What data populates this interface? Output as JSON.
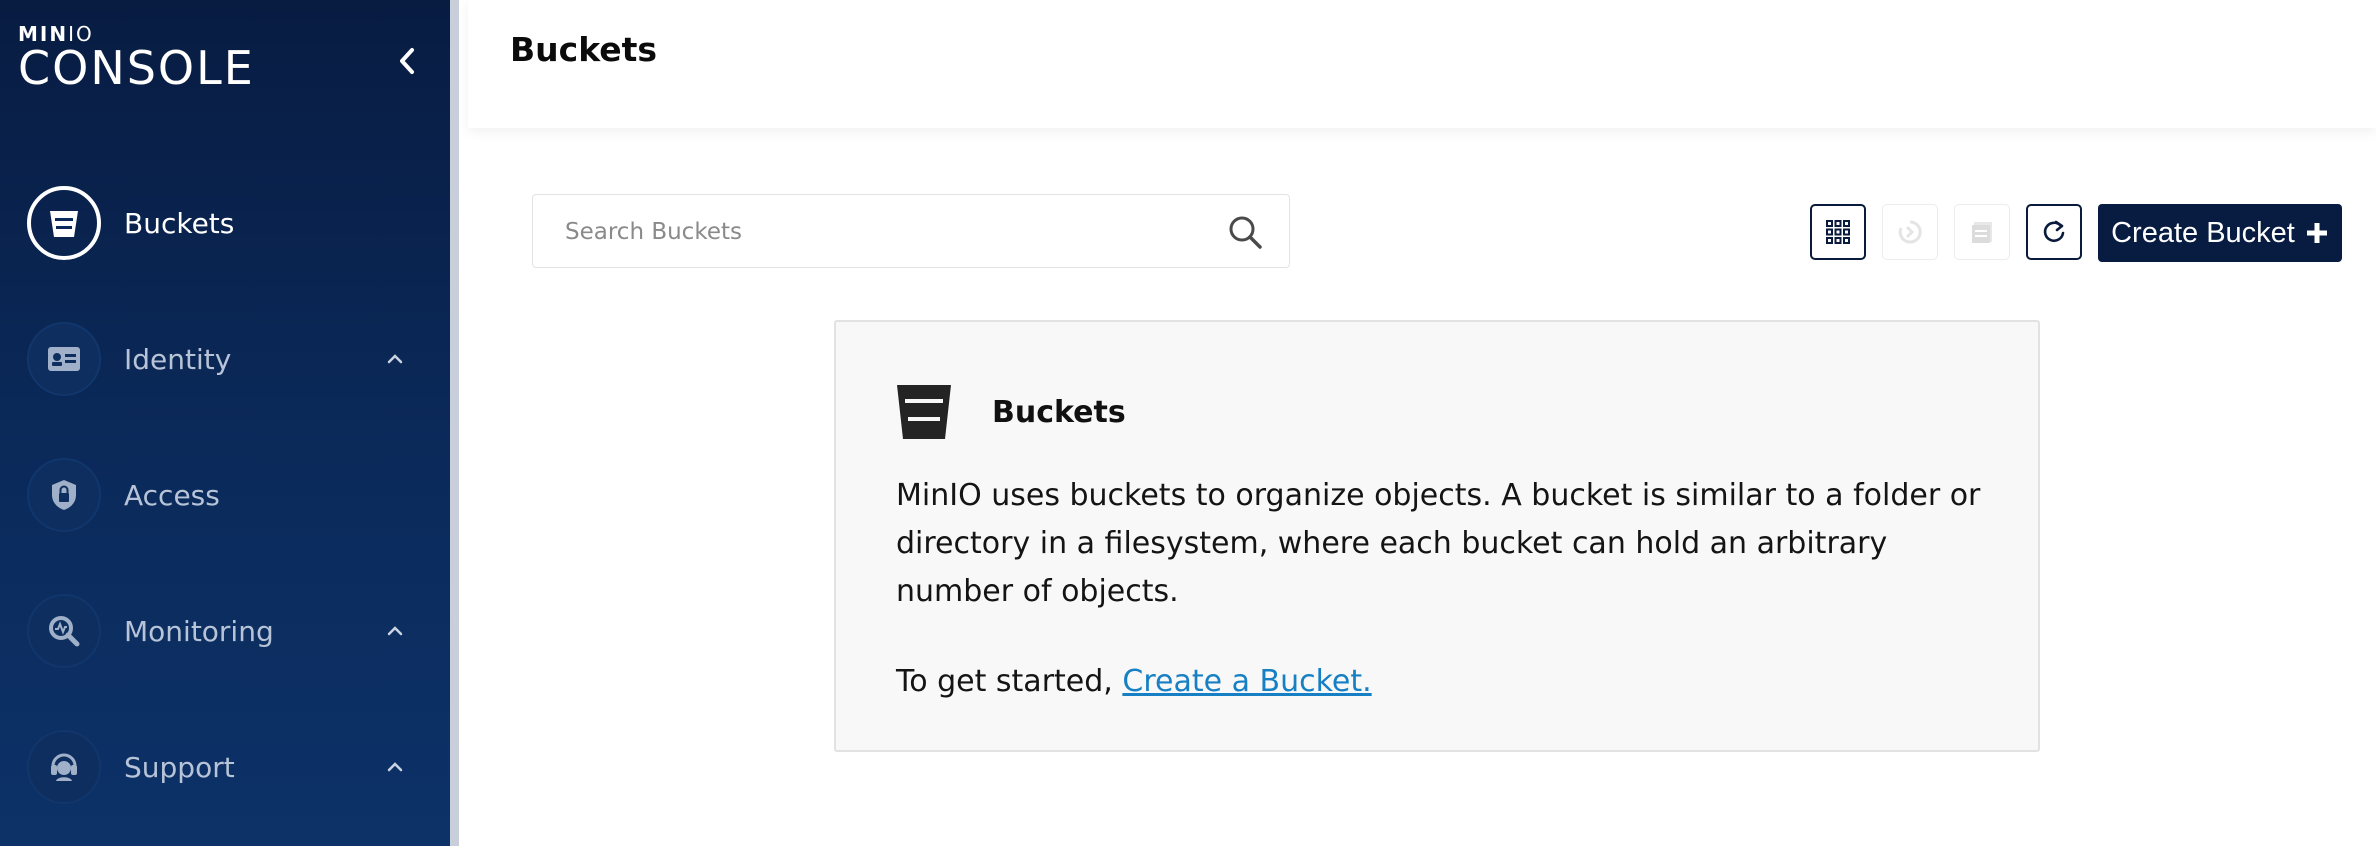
{
  "brand": {
    "top_prefix": "MIN",
    "top_suffix": "IO",
    "main": "CONSOLE"
  },
  "sidebar": {
    "items": [
      {
        "label": "Buckets",
        "icon": "bucket-icon",
        "active": true,
        "expandable": false
      },
      {
        "label": "Identity",
        "icon": "id-card-icon",
        "active": false,
        "expandable": true
      },
      {
        "label": "Access",
        "icon": "lock-shield-icon",
        "active": false,
        "expandable": false
      },
      {
        "label": "Monitoring",
        "icon": "monitoring-icon",
        "active": false,
        "expandable": true
      },
      {
        "label": "Support",
        "icon": "support-icon",
        "active": false,
        "expandable": true
      }
    ]
  },
  "header": {
    "title": "Buckets"
  },
  "search": {
    "placeholder": "Search Buckets",
    "value": ""
  },
  "toolbar": {
    "create_label": "Create Bucket",
    "buttons": [
      {
        "name": "grid-view-icon",
        "enabled": true
      },
      {
        "name": "rewind-icon",
        "enabled": false
      },
      {
        "name": "multi-delete-icon",
        "enabled": false
      },
      {
        "name": "refresh-icon",
        "enabled": true
      }
    ]
  },
  "card": {
    "title": "Buckets",
    "body": "MinIO uses buckets to organize objects. A bucket is similar to a folder or directory in a filesystem, where each bucket can hold an arbitrary number of objects.",
    "cta_prefix": "To get started,",
    "cta_link": "Create a Bucket."
  },
  "colors": {
    "sidebar_dark": "#081c42",
    "primary_button": "#081c42",
    "link": "#1780c4",
    "card_bg": "#f8f8f8"
  }
}
